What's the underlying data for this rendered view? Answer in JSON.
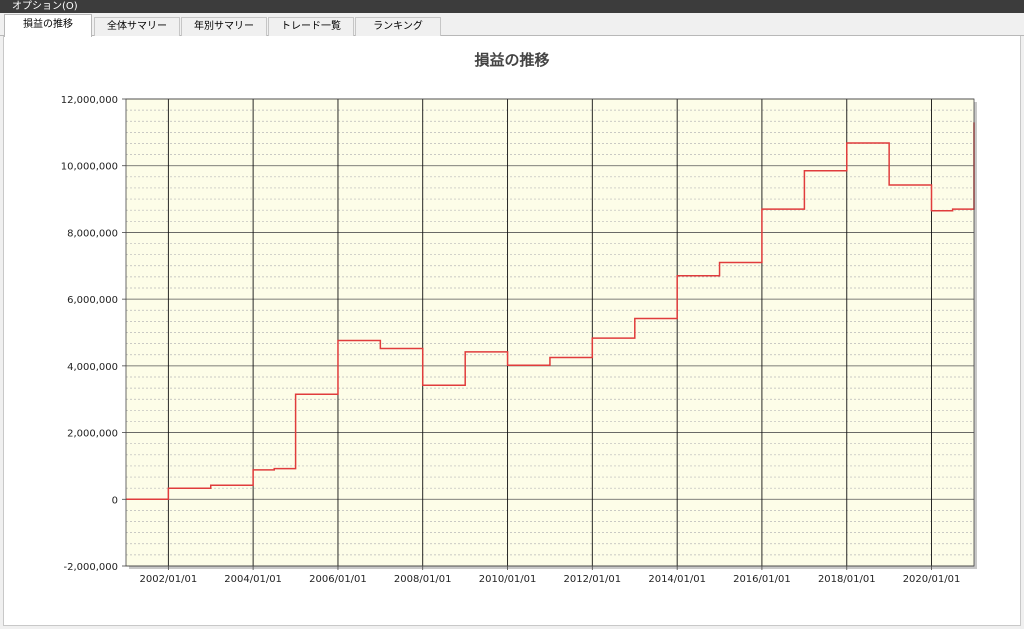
{
  "menu": {
    "options": "オプション(O)"
  },
  "tabs": [
    "損益の推移",
    "全体サマリー",
    "年別サマリー",
    "トレード一覧",
    "ランキング"
  ],
  "colors": {
    "plot_background": "#fdfde8",
    "line": "#e03c3c",
    "menubar": "#3c3c3c"
  },
  "chart_data": {
    "type": "line",
    "title": "損益の推移",
    "xlabel": "",
    "ylabel": "",
    "x_range": [
      "2001/01/01",
      "2021/01/01"
    ],
    "ylim": [
      -2000000,
      12000000
    ],
    "y_ticks": [
      -2000000,
      0,
      2000000,
      4000000,
      6000000,
      8000000,
      10000000,
      12000000
    ],
    "y_tick_labels": [
      "-2,000,000",
      "0",
      "2,000,000",
      "4,000,000",
      "6,000,000",
      "8,000,000",
      "10,000,000",
      "12,000,000"
    ],
    "x_ticks": [
      "2002/01/01",
      "2004/01/01",
      "2006/01/01",
      "2008/01/01",
      "2010/01/01",
      "2012/01/01",
      "2014/01/01",
      "2016/01/01",
      "2018/01/01",
      "2020/01/01"
    ],
    "grid": true,
    "legend": "none",
    "series": [
      {
        "step": true,
        "points": [
          [
            "2001/01/01",
            0
          ],
          [
            "2002/01/01",
            330000
          ],
          [
            "2003/01/01",
            420000
          ],
          [
            "2004/01/01",
            880000
          ],
          [
            "2004/07/01",
            920000
          ],
          [
            "2005/01/01",
            3150000
          ],
          [
            "2006/01/01",
            4760000
          ],
          [
            "2007/01/01",
            4520000
          ],
          [
            "2008/01/01",
            3420000
          ],
          [
            "2009/01/01",
            4420000
          ],
          [
            "2010/01/01",
            4020000
          ],
          [
            "2011/01/01",
            4250000
          ],
          [
            "2012/01/01",
            4830000
          ],
          [
            "2013/01/01",
            5420000
          ],
          [
            "2014/01/01",
            6700000
          ],
          [
            "2015/01/01",
            7100000
          ],
          [
            "2016/01/01",
            8700000
          ],
          [
            "2017/01/01",
            9850000
          ],
          [
            "2018/01/01",
            10680000
          ],
          [
            "2019/01/01",
            9420000
          ],
          [
            "2020/01/01",
            8650000
          ],
          [
            "2020/07/01",
            8700000
          ],
          [
            "2021/01/01",
            11300000
          ]
        ]
      }
    ]
  }
}
